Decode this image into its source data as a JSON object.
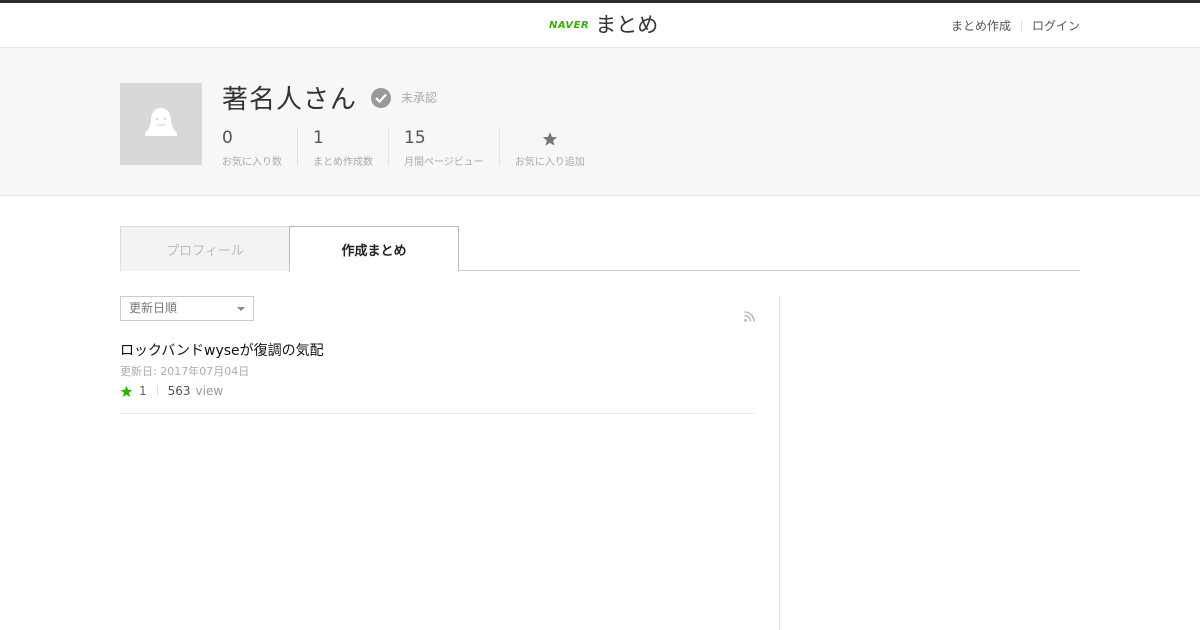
{
  "header": {
    "logo_naver": "NAVER",
    "logo_matome": "まとめ",
    "nav": {
      "create": "まとめ作成",
      "login": "ログイン"
    }
  },
  "profile": {
    "avatar_icon": "user-silhouette-icon",
    "name": "著名人さん",
    "verify_icon": "check-circle-icon",
    "verify_label": "未承認",
    "stats": [
      {
        "value": "0",
        "label": "お気に入り数"
      },
      {
        "value": "1",
        "label": "まとめ作成数"
      },
      {
        "value": "15",
        "label": "月間ページビュー"
      }
    ],
    "favorite_add": {
      "icon": "star-icon",
      "label": "お気に入り追加"
    }
  },
  "tabs": {
    "profile": "プロフィール",
    "created": "作成まとめ"
  },
  "list": {
    "sort_selected": "更新日順",
    "rss_icon": "rss-icon",
    "items": [
      {
        "title": "ロックバンドwyseが復調の気配",
        "date": "更新日: 2017年07月04日",
        "favorites": "1",
        "views": "563",
        "view_label": "view"
      }
    ]
  },
  "colors": {
    "accent_green": "#2db400",
    "top_bar": "#2b2b2b",
    "profile_bg": "#f7f7f7"
  }
}
